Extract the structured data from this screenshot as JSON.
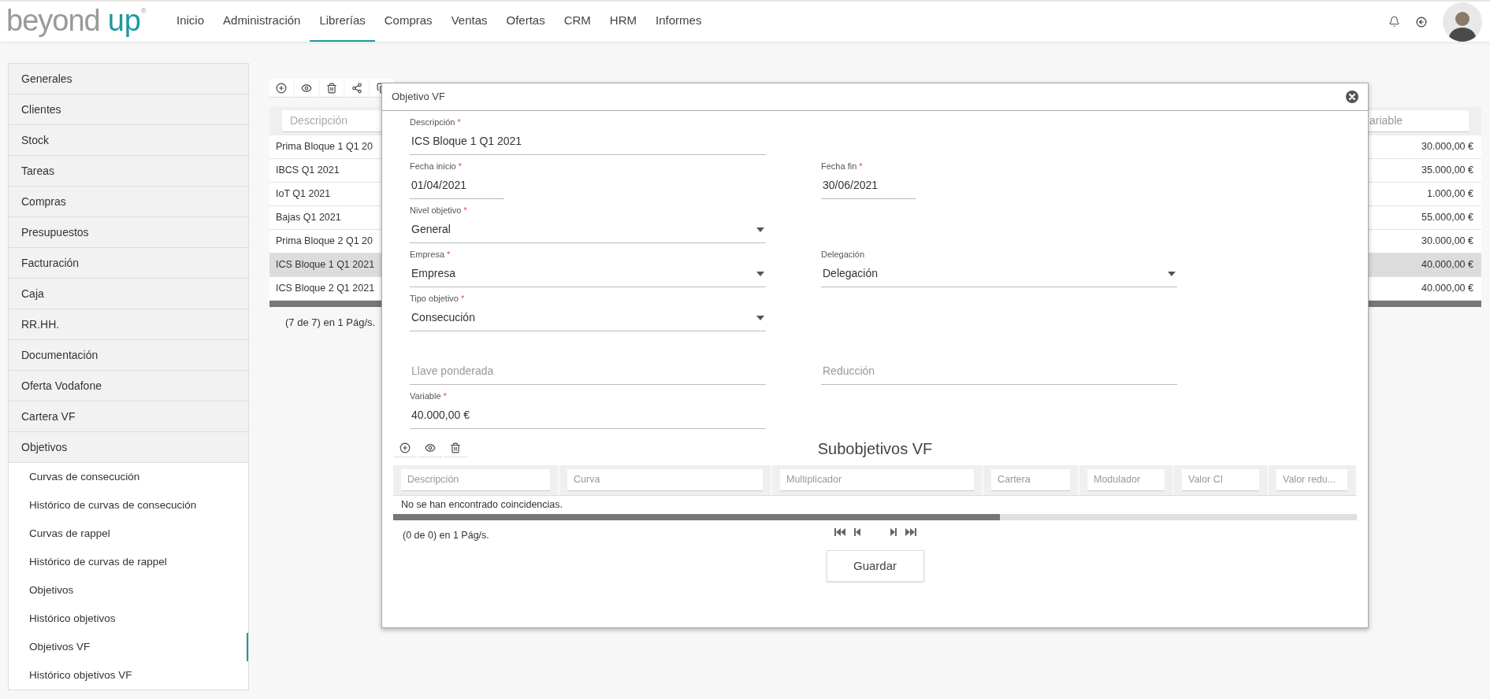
{
  "header": {
    "logo": {
      "word_1": "beyond",
      "word_2": "up",
      "mark": "®"
    },
    "nav": [
      {
        "label": "Inicio",
        "selected": false
      },
      {
        "label": "Administración",
        "selected": false
      },
      {
        "label": "Librerías",
        "selected": true
      },
      {
        "label": "Compras",
        "selected": false
      },
      {
        "label": "Ventas",
        "selected": false
      },
      {
        "label": "Ofertas",
        "selected": false
      },
      {
        "label": "CRM",
        "selected": false
      },
      {
        "label": "HRM",
        "selected": false
      },
      {
        "label": "Informes",
        "selected": false
      }
    ]
  },
  "sidebar": {
    "items": [
      {
        "label": "Generales"
      },
      {
        "label": "Clientes"
      },
      {
        "label": "Stock"
      },
      {
        "label": "Tareas"
      },
      {
        "label": "Compras"
      },
      {
        "label": "Presupuestos"
      },
      {
        "label": "Facturación"
      },
      {
        "label": "Caja"
      },
      {
        "label": "RR.HH."
      },
      {
        "label": "Documentación"
      },
      {
        "label": "Oferta Vodafone"
      },
      {
        "label": "Cartera VF"
      },
      {
        "label": "Objetivos",
        "children": [
          {
            "label": "Curvas de consecución",
            "selected": false
          },
          {
            "label": "Histórico de curvas de consecución",
            "selected": false
          },
          {
            "label": "Curvas de rappel",
            "selected": false
          },
          {
            "label": "Histórico de curvas de rappel",
            "selected": false
          },
          {
            "label": "Objetivos",
            "selected": false
          },
          {
            "label": "Histórico objetivos",
            "selected": false
          },
          {
            "label": "Objetivos VF",
            "selected": true
          },
          {
            "label": "Histórico objetivos VF",
            "selected": false
          }
        ]
      }
    ]
  },
  "table": {
    "columns": [
      {
        "placeholder": "Descripción"
      },
      {
        "placeholder": "ariable"
      }
    ],
    "rows": [
      {
        "cells": [
          "Prima Bloque 1 Q1 20",
          "30.000,00 €"
        ],
        "selected": false
      },
      {
        "cells": [
          "IBCS Q1 2021",
          "35.000,00 €"
        ],
        "selected": false
      },
      {
        "cells": [
          "IoT Q1 2021",
          "1.000,00 €"
        ],
        "selected": false
      },
      {
        "cells": [
          "Bajas Q1 2021",
          "55.000,00 €"
        ],
        "selected": false
      },
      {
        "cells": [
          "Prima Bloque 2 Q1 20",
          "30.000,00 €"
        ],
        "selected": false
      },
      {
        "cells": [
          "ICS Bloque 1 Q1 2021",
          "40.000,00 €"
        ],
        "selected": true
      },
      {
        "cells": [
          "ICS Bloque 2 Q1 2021",
          "40.000,00 €"
        ],
        "selected": false
      }
    ],
    "pager": "(7 de 7) en 1 Pág/s."
  },
  "modal": {
    "title": "Objetivo VF",
    "rows": [
      [
        {
          "kind": "text",
          "label": "Descripción",
          "required_mark": "*",
          "value": "ICS Bloque 1 Q1 2021"
        }
      ],
      [
        {
          "kind": "date",
          "label": "Fecha inicio",
          "required_mark": "*",
          "value": "01/04/2021"
        },
        {
          "kind": "date",
          "label": "Fecha fin",
          "required_mark": "*",
          "value": "30/06/2021"
        }
      ],
      [
        {
          "kind": "select",
          "label": "Nivel objetivo",
          "required_mark": "*",
          "value": "General"
        }
      ],
      [
        {
          "kind": "select",
          "label": "Empresa",
          "required_mark": "*",
          "value": "Empresa"
        },
        {
          "kind": "select",
          "label": "Delegación",
          "value": "Delegación"
        }
      ],
      [
        {
          "kind": "select",
          "label": "Tipo objetivo",
          "required_mark": "*",
          "value": "Consecución"
        }
      ],
      [
        {
          "kind": "text",
          "placeholder": "Llave ponderada"
        },
        {
          "kind": "text",
          "placeholder": "Reducción"
        }
      ],
      [
        {
          "kind": "text",
          "label": "Variable",
          "required_mark": "*",
          "value": "40.000,00 €"
        }
      ]
    ],
    "subtable": {
      "title": "Subobjetivos VF",
      "columns": [
        {
          "placeholder": "Descripción"
        },
        {
          "placeholder": "Curva"
        },
        {
          "placeholder": "Multiplicador"
        },
        {
          "placeholder": "Cartera"
        },
        {
          "placeholder": "Modulador"
        },
        {
          "placeholder": "Valor CI"
        },
        {
          "placeholder": "Valor redu..."
        }
      ],
      "empty": "No se han encontrado coincidencias.",
      "pager": "(0 de 0) en 1 Pág/s."
    },
    "save": "Guardar"
  }
}
